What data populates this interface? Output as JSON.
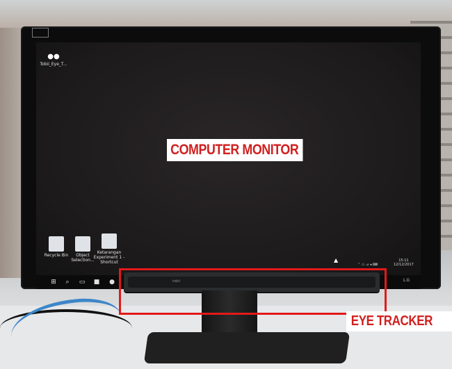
{
  "scene": {
    "callouts": {
      "monitor_label": "COMPUTER MONITOR",
      "tracker_label": "EYE TRACKER"
    },
    "desktop": {
      "icons": [
        {
          "label": "Tobii_Eye_T...",
          "icon": "eye-tracker-shortcut-icon"
        },
        {
          "label": "Recycle Bin",
          "icon": "recycle-bin-icon"
        },
        {
          "label": "Object Selection...",
          "icon": "program-icon"
        },
        {
          "label": "Ketarangan Experiment 1 - Shortcut",
          "icon": "document-shortcut-icon"
        }
      ],
      "taskbar_icons": [
        "windows-start-icon",
        "search-icon",
        "task-view-icon",
        "file-explorer-icon",
        "chrome-icon",
        "store-icon",
        "app-icon",
        "spotify-icon",
        "settings-icon"
      ],
      "clock": {
        "time": "15:11",
        "date": "12/12/2017"
      }
    },
    "monitor_brand": "LG",
    "colors": {
      "callout_red": "#e21a1a",
      "screen": "#1c1a1b",
      "cable": "#3d86c8"
    }
  }
}
